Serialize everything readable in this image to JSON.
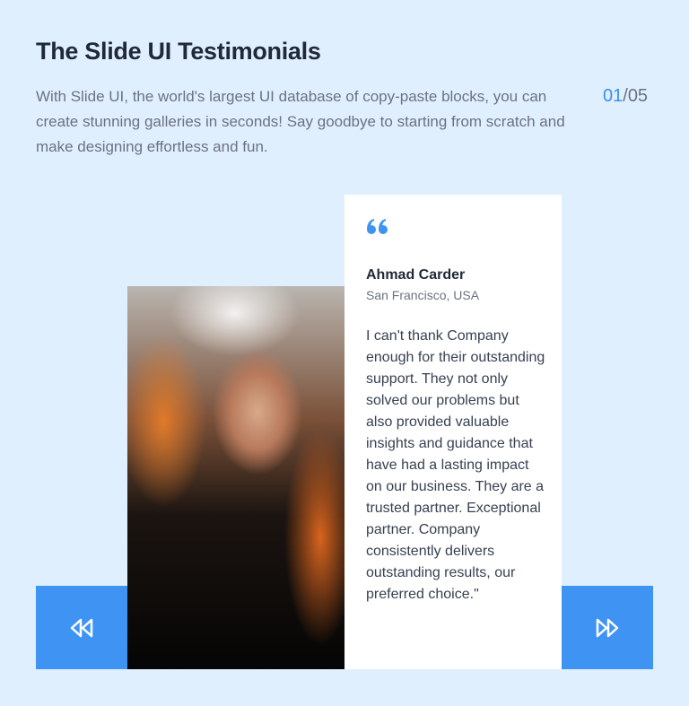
{
  "header": {
    "title": "The Slide UI Testimonials",
    "description": "With Slide UI, the world's largest UI database of copy-paste blocks, you can create stunning galleries in seconds! Say goodbye to starting from scratch and make designing effortless and fun.",
    "counter": {
      "current": "01",
      "separator": "/",
      "total": "05"
    }
  },
  "testimonial": {
    "quote_icon": "quote-icon",
    "name": "Ahmad Carder",
    "location": "San Francisco, USA",
    "text": "I can't thank Company enough for their outstanding support. They not only solved our problems but also provided valuable insights and guidance that have had a lasting impact on our business. They are a trusted partner. Exceptional partner. Company consistently delivers outstanding results, our preferred choice.\""
  },
  "navigation": {
    "prev_icon": "rewind-icon",
    "next_icon": "fast-forward-icon"
  },
  "colors": {
    "accent": "#3f93f3",
    "background": "#e0effe"
  }
}
